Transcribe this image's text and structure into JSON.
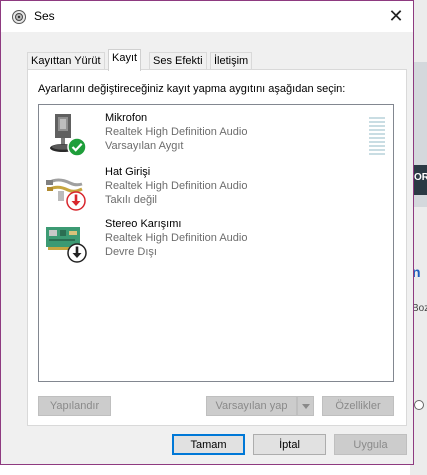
{
  "window": {
    "title": "Ses"
  },
  "tabs": [
    {
      "label": "Kayıttan Yürüt"
    },
    {
      "label": "Kayıt"
    },
    {
      "label": "Ses Efekti"
    },
    {
      "label": "İletişim"
    }
  ],
  "active_tab": "Kayıt",
  "instruction": "Ayarlarını değiştireceğiniz kayıt yapma aygıtını aşağıdan seçin:",
  "devices": [
    {
      "name": "Mikrofon",
      "driver": "Realtek High Definition Audio",
      "status": "Varsayılan Aygıt",
      "icon": "microphone-icon",
      "badge": "green-check-icon"
    },
    {
      "name": "Hat Girişi",
      "driver": "Realtek High Definition Audio",
      "status": "Takılı değil",
      "icon": "line-in-cable-icon",
      "badge": "red-down-arrow-icon"
    },
    {
      "name": "Stereo Karışımı",
      "driver": "Realtek High Definition Audio",
      "status": "Devre Dışı",
      "icon": "sound-card-icon",
      "badge": "black-down-arrow-icon"
    }
  ],
  "panel_buttons": {
    "configure": "Yapılandır",
    "set_default": "Varsayılan yap",
    "properties": "Özellikler"
  },
  "footer_buttons": {
    "ok": "Tamam",
    "cancel": "İptal",
    "apply": "Uygula"
  },
  "background_app": {
    "fragment_1": "ORI",
    "fragment_2": "n",
    "fragment_3": "Boz"
  },
  "colors": {
    "accent": "#0078d7",
    "window_border": "#8e3a80",
    "check_green": "#1e9e3a",
    "arrow_red": "#d8262d"
  }
}
